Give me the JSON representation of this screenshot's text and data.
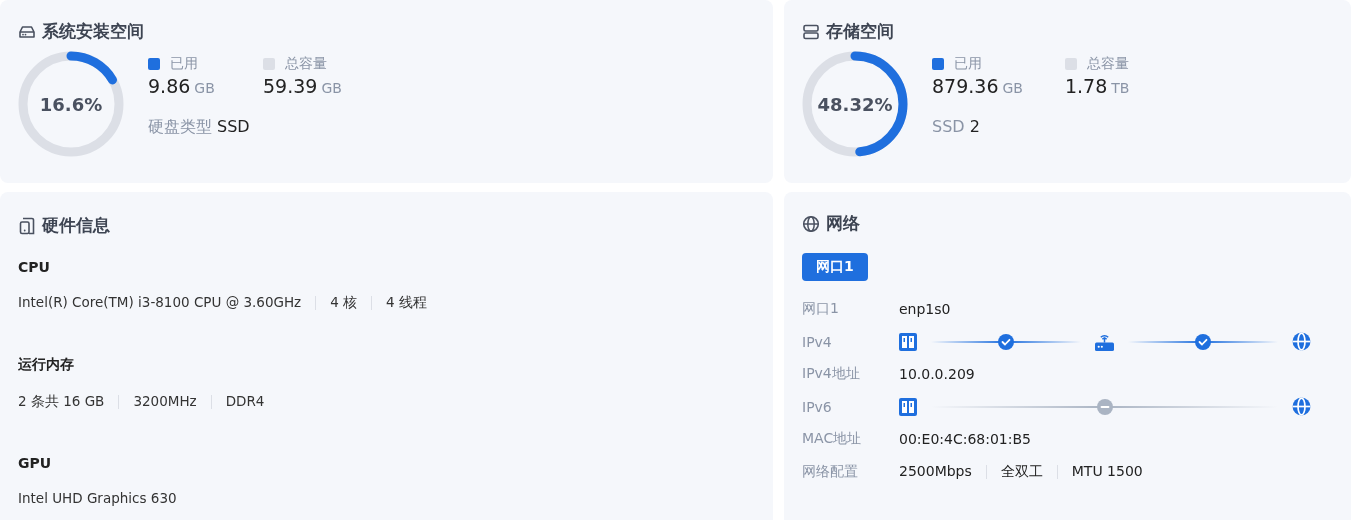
{
  "disks": [
    {
      "kind": "system",
      "title": "系统安装空间",
      "percent": "16.6%",
      "legend": [
        {
          "label": "已用",
          "color": "#1f6fde",
          "value": "9.86",
          "unit": "GB"
        },
        {
          "label": "总容量",
          "color": "#dcdfe6",
          "value": "59.39",
          "unit": "GB"
        }
      ],
      "detail": {
        "label": "硬盘类型",
        "value": "SSD"
      }
    },
    {
      "kind": "storage",
      "title": "存储空间",
      "percent": "48.32%",
      "legend": [
        {
          "label": "已用",
          "color": "#1f6fde",
          "value": "879.36",
          "unit": "GB"
        },
        {
          "label": "总容量",
          "color": "#dcdfe6",
          "value": "1.78",
          "unit": "TB"
        }
      ],
      "detail": {
        "label": "SSD",
        "value": "2"
      }
    }
  ],
  "hardware": {
    "title": "硬件信息",
    "sections": [
      {
        "name": "CPU",
        "parts": [
          "Intel(R) Core(TM) i3-8100 CPU @ 3.60GHz",
          "4 核",
          "4 线程"
        ]
      },
      {
        "name": "运行内存",
        "parts": [
          "2 条共 16 GB",
          "3200MHz",
          "DDR4"
        ]
      },
      {
        "name": "GPU",
        "parts": [
          "Intel UHD Graphics 630"
        ]
      }
    ]
  },
  "network": {
    "title": "网络",
    "tabs": [
      {
        "label": "网口1",
        "selected": true
      }
    ],
    "rows": [
      {
        "kind": "text",
        "label": "网口1",
        "parts": [
          "enp1s0"
        ]
      },
      {
        "kind": "path",
        "label": "IPv4",
        "links": [
          {
            "connected": true
          },
          {
            "connected": true
          }
        ]
      },
      {
        "kind": "text",
        "label": "IPv4地址",
        "parts": [
          "10.0.0.209"
        ]
      },
      {
        "kind": "path",
        "label": "IPv6",
        "links": [
          {
            "connected": false
          }
        ]
      },
      {
        "kind": "text",
        "label": "MAC地址",
        "parts": [
          "00:E0:4C:68:01:B5"
        ]
      },
      {
        "kind": "text",
        "label": "网络配置",
        "parts": [
          "2500Mbps",
          "全双工",
          "MTU 1500"
        ]
      }
    ]
  }
}
